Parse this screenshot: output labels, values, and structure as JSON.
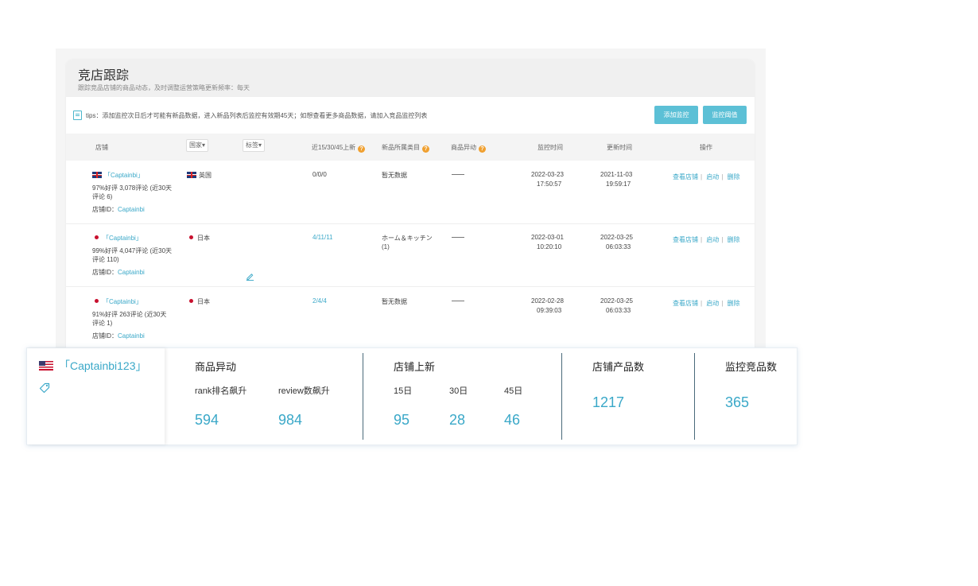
{
  "header": {
    "title": "竞店跟踪",
    "subtitle": "跟踪竞品店铺的商品动态，及时调整运营策略更新频率：每天"
  },
  "tips": {
    "text": "tips：添加监控次日后才可能有新品数据，进入新品列表后监控有效期45天；如想查看更多商品数据，请加入竞品监控列表",
    "add_button": "添加监控",
    "threshold_button": "监控阈值"
  },
  "table": {
    "columns": {
      "store": "店铺",
      "country_filter": "国家▾",
      "tag_filter": "标签▾",
      "new_counts": "近15/30/45上新",
      "category": "新品所属类目",
      "anomaly": "商品异动",
      "monitor_time": "监控时间",
      "update_time": "更新时间",
      "actions": "操作"
    },
    "rows": [
      {
        "store_name": "「Captainbi」",
        "rating_line1": "97%好评 3,078评论 (近30天",
        "rating_line2": "评论 6)",
        "store_id_label": "店铺ID：",
        "store_id": "Captainbi",
        "country": "英国",
        "new_counts": "0/0/0",
        "category_line1": "暂无数据",
        "category_line2": "",
        "monitor_date": "2022-03-23",
        "monitor_clock": "17:50:57",
        "update_date": "2021-11-03",
        "update_clock": "19:59:17",
        "action_view": "查看店铺",
        "action_start": "启动",
        "action_delete": "删除"
      },
      {
        "store_name": "「Captainbi」",
        "rating_line1": "99%好评 4,047评论 (近30天",
        "rating_line2": "评论 110)",
        "store_id_label": "店铺ID：",
        "store_id": "Captainbi",
        "country": "日本",
        "new_counts": "4/11/11",
        "category_line1": "ホーム＆キッチン",
        "category_line2": "(1)",
        "monitor_date": "2022-03-01",
        "monitor_clock": "10:20:10",
        "update_date": "2022-03-25",
        "update_clock": "06:03:33",
        "action_view": "查看店铺",
        "action_start": "启动",
        "action_delete": "删除"
      },
      {
        "store_name": "「Captainbi」",
        "rating_line1": "91%好评 263评论 (近30天",
        "rating_line2": "评论 1)",
        "store_id_label": "店铺ID：",
        "store_id": "Captainbi",
        "country": "日本",
        "new_counts": "2/4/4",
        "category_line1": "暂无数据",
        "category_line2": "",
        "monitor_date": "2022-02-28",
        "monitor_clock": "09:39:03",
        "update_date": "2022-03-25",
        "update_clock": "06:03:33",
        "action_view": "查看店铺",
        "action_start": "启动",
        "action_delete": "删除"
      }
    ]
  },
  "panel": {
    "store_name": "「Captainbi123」",
    "anomaly": {
      "title": "商品异动",
      "rank_label": "rank排名飙升",
      "rank_value": "594",
      "review_label": "review数飙升",
      "review_value": "984"
    },
    "new_listings": {
      "title": "店铺上新",
      "d15_label": "15日",
      "d15_value": "95",
      "d30_label": "30日",
      "d30_value": "28",
      "d45_label": "45日",
      "d45_value": "46"
    },
    "product_count": {
      "title": "店铺产品数",
      "value": "1217"
    },
    "competitor_count": {
      "title": "监控竞品数",
      "value": "365"
    }
  },
  "colors": {
    "accent": "#3aa8c8",
    "button": "#5cc0d6",
    "help": "#f0a030"
  }
}
